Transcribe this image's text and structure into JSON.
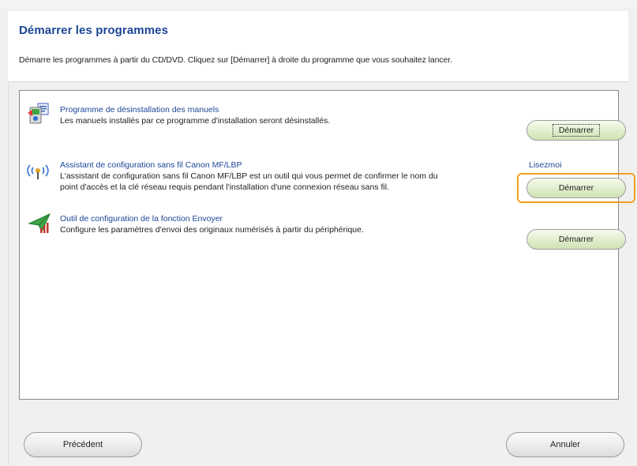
{
  "page": {
    "title": "Démarrer les programmes",
    "description": "Démarre les programmes à partir du CD/DVD. Cliquez sur [Démarrer] à droite du programme que vous souhaitez lancer."
  },
  "programs": [
    {
      "title": "Programme de désinstallation des manuels",
      "description": "Les manuels installés par ce programme d'installation seront désinstallés.",
      "icon": "uninstall-manuals-icon",
      "button_label": "Démarrer"
    },
    {
      "title": "Assistant de configuration sans fil Canon MF/LBP",
      "description_line1": "L'assistant de configuration sans fil Canon MF/LBP est un outil qui vous permet de confirmer le nom du",
      "description_line2": "point d'accès et la clé réseau requis pendant l'installation d'une connexion réseau sans fil.",
      "readme_label": "Lisezmoi",
      "icon": "wireless-icon",
      "button_label": "Démarrer"
    },
    {
      "title": "Outil de configuration de la fonction Envoyer",
      "description": "Configure les paramètres d'envoi des originaux numérisés à partir du périphérique.",
      "icon": "send-function-icon",
      "button_label": "Démarrer"
    }
  ],
  "nav": {
    "back_label": "Précédent",
    "cancel_label": "Annuler"
  },
  "colors": {
    "accent_title": "#1d4597",
    "highlight": "#f0a020",
    "start_button": "#d9eac2"
  }
}
